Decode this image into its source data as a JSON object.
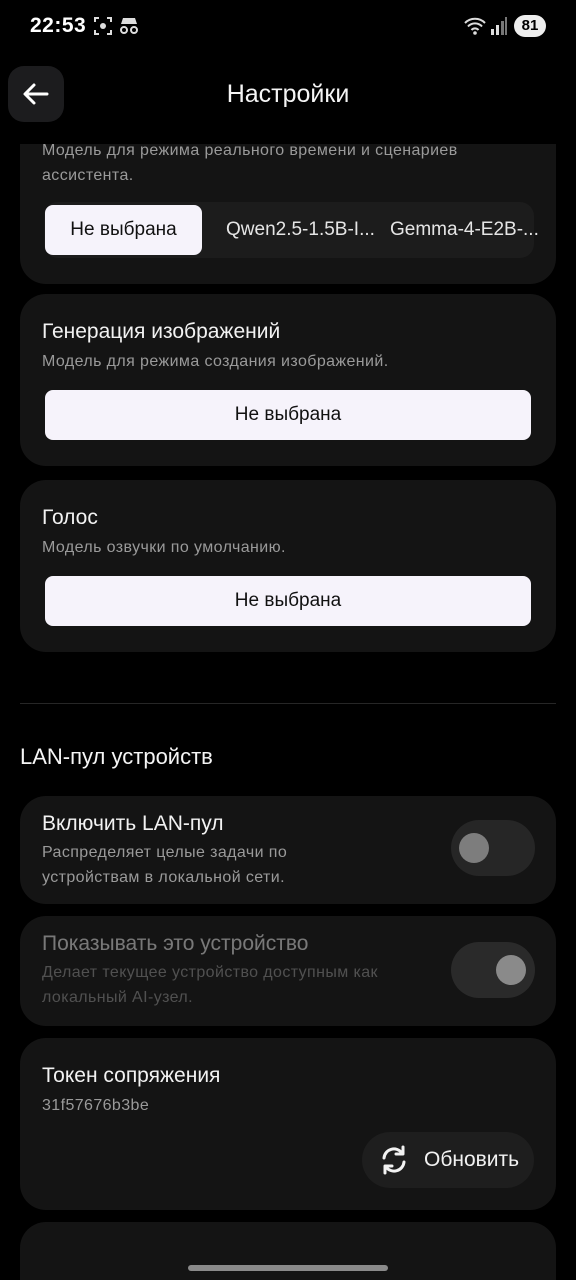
{
  "status_bar": {
    "time": "22:53",
    "battery": "81"
  },
  "header": {
    "title": "Настройки"
  },
  "assistant_card": {
    "desc": "Модель для режима реального времени и сценариев ассистента.",
    "options": [
      "Не выбрана",
      "Qwen2.5-1.5B-I...",
      "Gemma-4-E2B-..."
    ]
  },
  "image_card": {
    "title": "Генерация изображений",
    "desc": "Модель для режима создания изображений.",
    "value": "Не выбрана"
  },
  "voice_card": {
    "title": "Голос",
    "desc": "Модель озвучки по умолчанию.",
    "value": "Не выбрана"
  },
  "lan": {
    "section_title": "LAN-пул устройств",
    "enable": {
      "title": "Включить LAN-пул",
      "desc": "Распределяет целые задачи по устройствам в локальной сети.",
      "on": false
    },
    "show_device": {
      "title": "Показывать это устройство",
      "desc": "Делает текущее устройство доступным как локальный AI-узел.",
      "on": true,
      "disabled": true
    },
    "token": {
      "title": "Токен сопряжения",
      "value": "31f57676b3be",
      "refresh_label": "Обновить"
    }
  }
}
